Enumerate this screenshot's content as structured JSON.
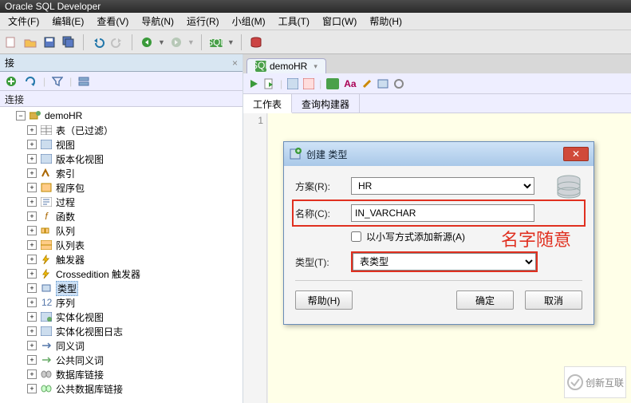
{
  "app": {
    "title": "Oracle SQL Developer"
  },
  "menu": {
    "file": "文件(F)",
    "edit": "编辑(E)",
    "view": "查看(V)",
    "nav": "导航(N)",
    "run": "运行(R)",
    "team": "小组(M)",
    "tools": "工具(T)",
    "window": "窗口(W)",
    "help": "帮助(H)"
  },
  "left": {
    "tab_label": "接",
    "section_label": "连接",
    "root": "demoHR",
    "nodes": [
      {
        "label": "表（已过滤）"
      },
      {
        "label": "视图"
      },
      {
        "label": "版本化视图"
      },
      {
        "label": "索引"
      },
      {
        "label": "程序包"
      },
      {
        "label": "过程"
      },
      {
        "label": "函数"
      },
      {
        "label": "队列"
      },
      {
        "label": "队列表"
      },
      {
        "label": "触发器"
      },
      {
        "label": "Crossedition 触发器"
      },
      {
        "label": "类型",
        "selected": true
      },
      {
        "label": "序列"
      },
      {
        "label": "实体化视图"
      },
      {
        "label": "实体化视图日志"
      },
      {
        "label": "同义词"
      },
      {
        "label": "公共同义词"
      },
      {
        "label": "数据库链接"
      },
      {
        "label": "公共数据库链接"
      }
    ]
  },
  "editor": {
    "tab": "demoHR",
    "subtab_worksheet": "工作表",
    "subtab_builder": "查询构建器",
    "line_no": "1"
  },
  "dialog": {
    "title": "创建 类型",
    "scheme_label": "方案(R):",
    "scheme_value": "HR",
    "name_label": "名称(C):",
    "name_value": "IN_VARCHAR",
    "lowercase_label": "以小写方式添加新源(A)",
    "type_label": "类型(T):",
    "type_value": "表类型",
    "help": "帮助(H)",
    "ok": "确定",
    "cancel": "取消"
  },
  "annotation": "名字随意",
  "watermark": "创新互联"
}
